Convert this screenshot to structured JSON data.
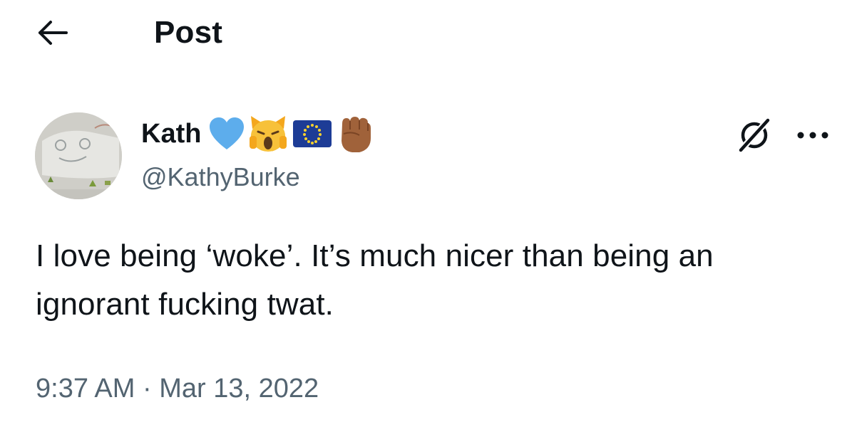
{
  "header": {
    "title": "Post",
    "back_icon": "arrow-left-icon"
  },
  "author": {
    "display_name": "Kath",
    "handle": "@KathyBurke",
    "name_emojis": [
      "blue-heart-emoji",
      "weary-cat-emoji",
      "eu-flag-emoji",
      "raised-fist-emoji"
    ]
  },
  "actions": {
    "grok_icon": "grok-icon",
    "more_icon": "more-dots-icon"
  },
  "post": {
    "line1": "I love being ‘woke’. It’s much nicer than being an",
    "line2": "ignorant fucking twat."
  },
  "meta": {
    "time": "9:37 AM",
    "separator": " · ",
    "date": "Mar 13, 2022"
  },
  "colors": {
    "text": "#0f1419",
    "secondary": "#536471",
    "background": "#ffffff"
  }
}
